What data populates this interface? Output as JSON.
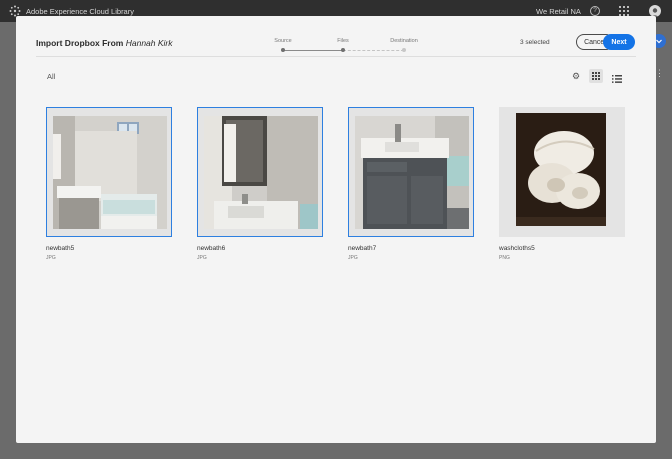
{
  "topbar": {
    "app_title": "Adobe Experience Cloud Library",
    "org": "We Retail NA",
    "help": "?"
  },
  "modal": {
    "title_prefix": "Import Dropbox From",
    "title_user": "Hannah Kirk",
    "steps": [
      {
        "label": "Source",
        "state": "done"
      },
      {
        "label": "Files",
        "state": "current"
      },
      {
        "label": "Destination",
        "state": "pending"
      }
    ],
    "selected_count": "3 selected",
    "cancel_label": "Cancel",
    "next_label": "Next",
    "filter_label": "All"
  },
  "files": [
    {
      "name": "newbath5",
      "type": "JPG",
      "selected": true
    },
    {
      "name": "newbath6",
      "type": "JPG",
      "selected": true
    },
    {
      "name": "newbath7",
      "type": "JPG",
      "selected": true
    },
    {
      "name": "washcloths5",
      "type": "PNG",
      "selected": false
    }
  ],
  "colors": {
    "accent": "#1473e6",
    "selection_border": "#2d7fe0",
    "topbar": "#2f2f2f",
    "modal_bg": "#f4f4f4"
  },
  "icons": [
    "adobe-logo-icon",
    "help-icon",
    "apps-grid-icon",
    "avatar-icon",
    "gear-icon",
    "grid-view-icon",
    "list-view-icon"
  ]
}
